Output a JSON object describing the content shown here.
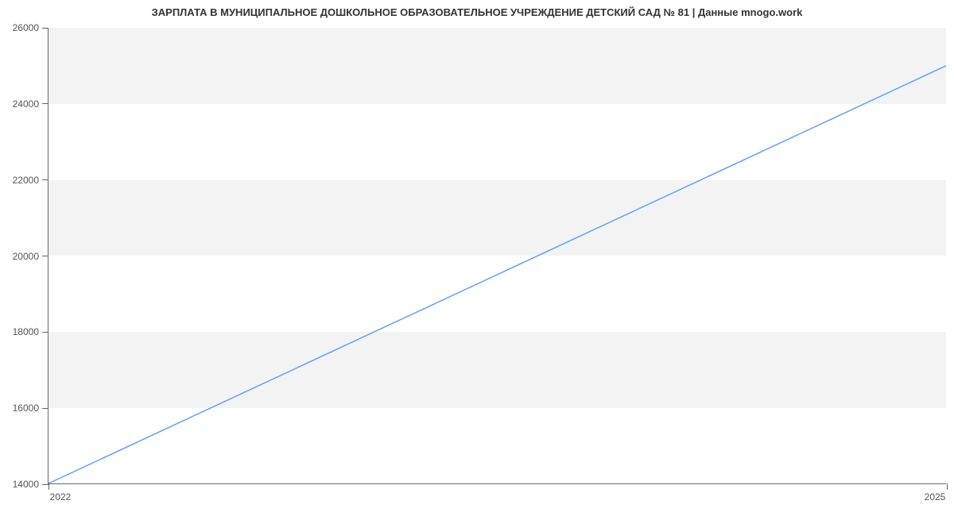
{
  "chart_data": {
    "type": "line",
    "title": "ЗАРПЛАТА В МУНИЦИПАЛЬНОЕ ДОШКОЛЬНОЕ ОБРАЗОВАТЕЛЬНОЕ УЧРЕЖДЕНИЕ ДЕТСКИЙ САД № 81 | Данные mnogo.work",
    "xlabel": "",
    "ylabel": "",
    "x": [
      2022,
      2025
    ],
    "values": [
      14000,
      25000
    ],
    "xlim": [
      2022,
      2025
    ],
    "ylim": [
      14000,
      26000
    ],
    "x_ticks": [
      2022,
      2025
    ],
    "y_ticks": [
      14000,
      16000,
      18000,
      20000,
      22000,
      24000,
      26000
    ],
    "y_tick_labels": [
      "14000",
      "16000",
      "18000",
      "20000",
      "22000",
      "24000",
      "26000"
    ],
    "x_tick_labels": [
      "2022",
      "2025"
    ],
    "line_color": "#6a9ef0"
  }
}
